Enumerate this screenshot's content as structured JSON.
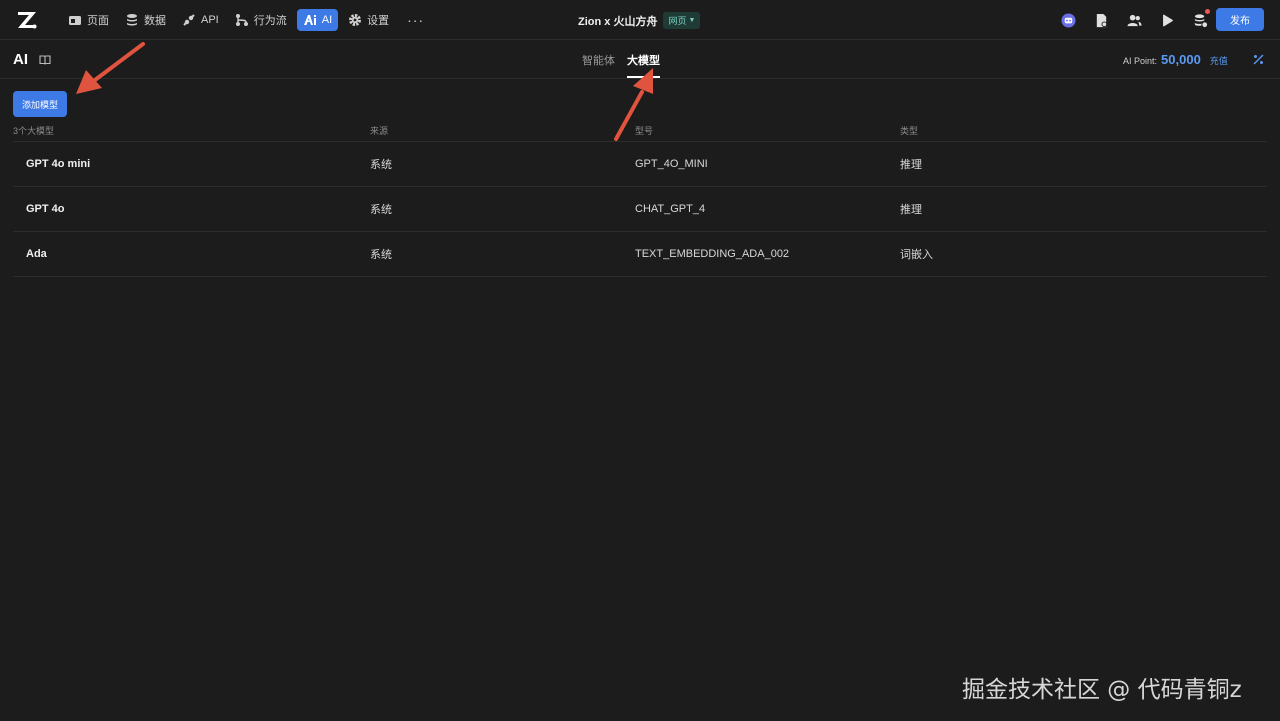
{
  "topbar": {
    "nav": [
      {
        "label": "页面",
        "icon": "page-icon"
      },
      {
        "label": "数据",
        "icon": "database-icon"
      },
      {
        "label": "API",
        "icon": "api-icon"
      },
      {
        "label": "行为流",
        "icon": "flow-icon"
      },
      {
        "label": "AI",
        "icon": "ai-icon",
        "active": true
      },
      {
        "label": "设置",
        "icon": "gear-icon"
      }
    ],
    "more": "···",
    "project_name": "Zion x 火山方舟",
    "env_badge": "网页",
    "publish_label": "发布"
  },
  "subbar": {
    "title": "AI",
    "tabs": [
      {
        "label": "智能体",
        "active": false
      },
      {
        "label": "大模型",
        "active": true
      }
    ],
    "ai_point_label": "AI Point:",
    "ai_point_value": "50,000",
    "recharge_label": "充值"
  },
  "main": {
    "add_button_label": "添加模型",
    "columns": [
      "3个大模型",
      "来源",
      "型号",
      "类型"
    ],
    "rows": [
      {
        "name": "GPT 4o mini",
        "source": "系统",
        "model": "GPT_4O_MINI",
        "type": "推理"
      },
      {
        "name": "GPT 4o",
        "source": "系统",
        "model": "CHAT_GPT_4",
        "type": "推理"
      },
      {
        "name": "Ada",
        "source": "系统",
        "model": "TEXT_EMBEDDING_ADA_002",
        "type": "词嵌入"
      }
    ]
  },
  "watermark": "掘金技术社区 @ 代码青铜z",
  "colors": {
    "background": "#1c1c1c",
    "accent": "#3d7ae6",
    "annotation_arrow": "#e0533e"
  }
}
